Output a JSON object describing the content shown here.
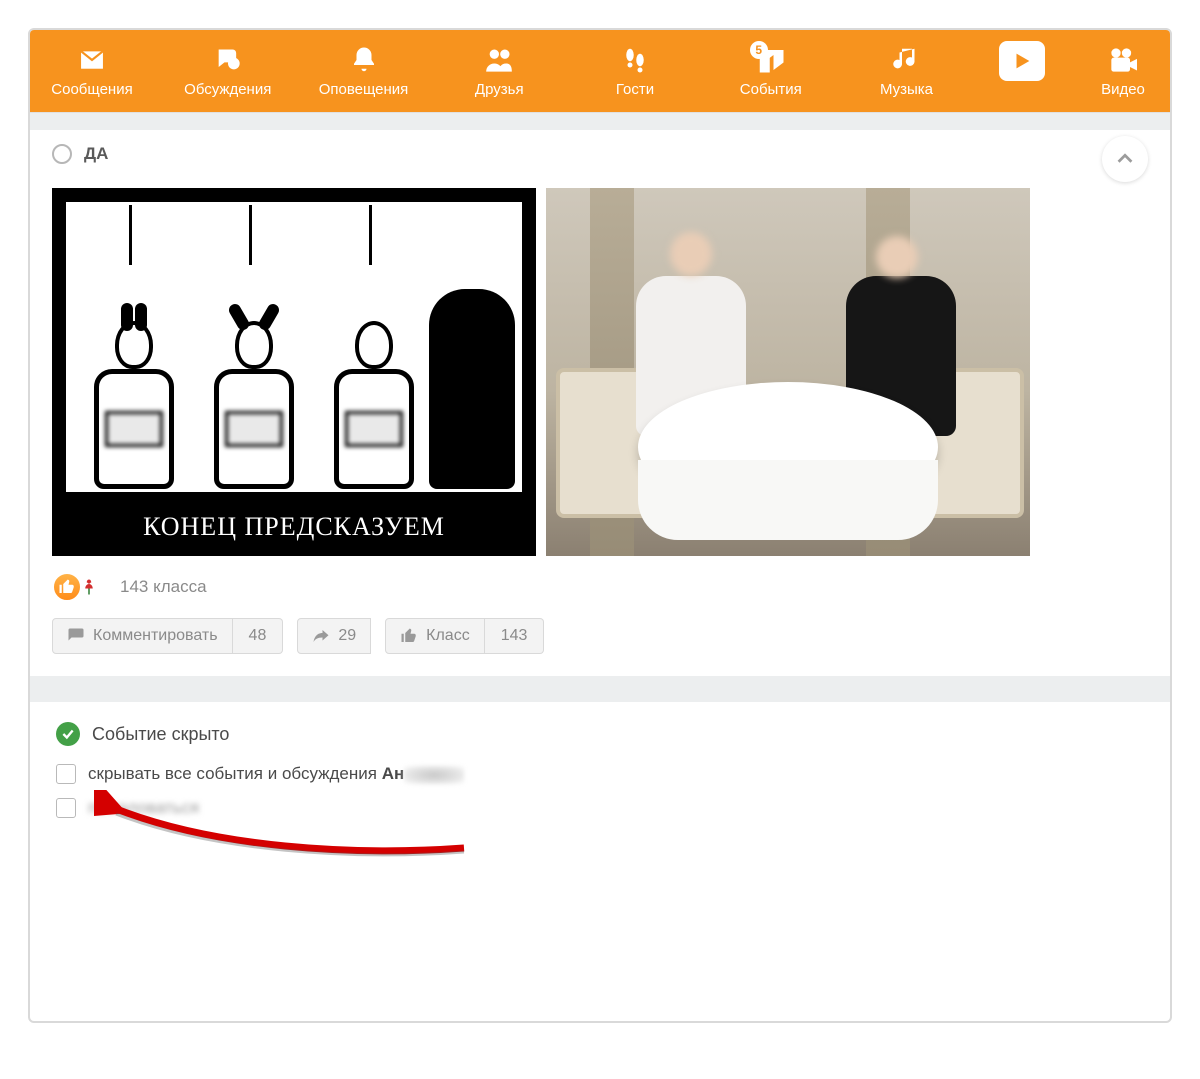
{
  "nav": {
    "messages": "Сообщения",
    "discussions": "Обсуждения",
    "notifications": "Оповещения",
    "friends": "Друзья",
    "guests": "Гости",
    "events": "События",
    "events_badge": "5",
    "music": "Музыка",
    "video": "Видео"
  },
  "poll": {
    "option1": "ДА"
  },
  "images": {
    "left_caption": "КОНЕЦ ПРЕДСКАЗУЕМ"
  },
  "reactions": {
    "count_text": "143 класса"
  },
  "actions": {
    "comment_label": "Комментировать",
    "comment_count": "48",
    "share_count": "29",
    "class_label": "Класс",
    "class_count": "143"
  },
  "hidden_panel": {
    "title": "Событие скрыто",
    "opt_hide_all_prefix": "скрывать все события и обсуждения ",
    "opt_hide_all_name_visible": "Ан",
    "opt_complain": "пожаловаться"
  }
}
